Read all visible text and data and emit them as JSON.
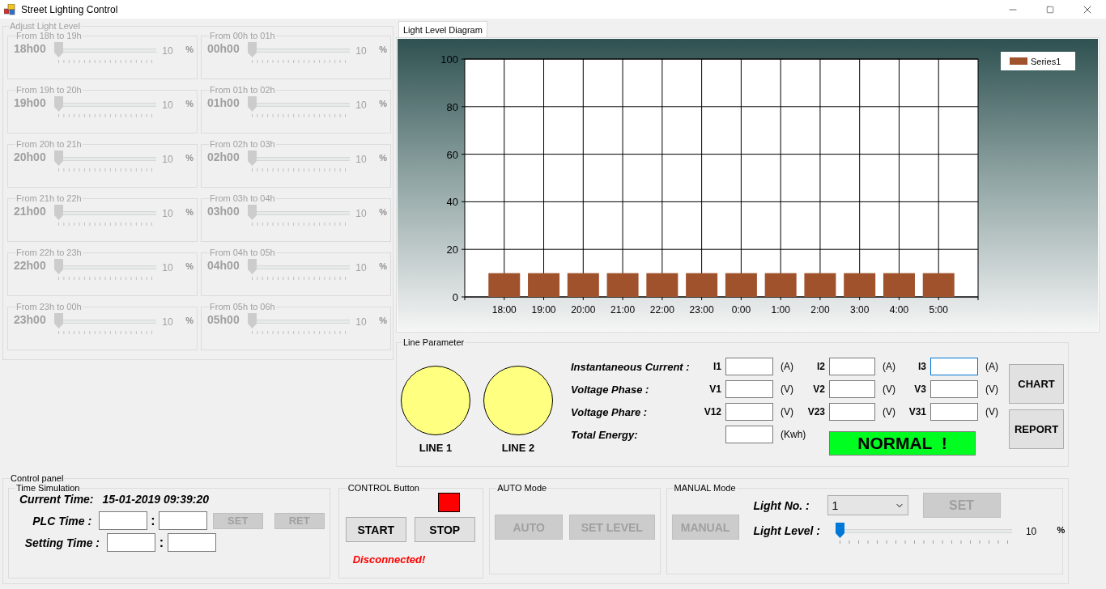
{
  "window": {
    "title": "Street Lighting Control"
  },
  "adjust_light_level": {
    "title": "Adjust Light Level",
    "disabled": true,
    "slots": [
      {
        "title": "From 18h to 19h",
        "hour": "18h00",
        "level": 0,
        "value": "10",
        "unit": "%"
      },
      {
        "title": "From 00h to 01h",
        "hour": "00h00",
        "level": 0,
        "value": "10",
        "unit": "%"
      },
      {
        "title": "From 19h to 20h",
        "hour": "19h00",
        "level": 0,
        "value": "10",
        "unit": "%"
      },
      {
        "title": "From 01h to 02h",
        "hour": "01h00",
        "level": 0,
        "value": "10",
        "unit": "%"
      },
      {
        "title": "From 20h to 21h",
        "hour": "20h00",
        "level": 0,
        "value": "10",
        "unit": "%"
      },
      {
        "title": "From 02h to 03h",
        "hour": "02h00",
        "level": 0,
        "value": "10",
        "unit": "%"
      },
      {
        "title": "From 21h to 22h",
        "hour": "21h00",
        "level": 0,
        "value": "10",
        "unit": "%"
      },
      {
        "title": "From 03h to 04h",
        "hour": "03h00",
        "level": 0,
        "value": "10",
        "unit": "%"
      },
      {
        "title": "From 22h to 23h",
        "hour": "22h00",
        "level": 0,
        "value": "10",
        "unit": "%"
      },
      {
        "title": "From 04h to 05h",
        "hour": "04h00",
        "level": 0,
        "value": "10",
        "unit": "%"
      },
      {
        "title": "From 23h to 00h",
        "hour": "23h00",
        "level": 0,
        "value": "10",
        "unit": "%"
      },
      {
        "title": "From 05h to 06h",
        "hour": "05h00",
        "level": 0,
        "value": "10",
        "unit": "%"
      }
    ]
  },
  "light_level_diagram": {
    "tab": {
      "label": "Light Level Diagram",
      "selected": true
    },
    "chart_data": {
      "type": "bar",
      "categories": [
        "18:00",
        "19:00",
        "20:00",
        "21:00",
        "22:00",
        "23:00",
        "0:00",
        "1:00",
        "2:00",
        "3:00",
        "4:00",
        "5:00"
      ],
      "series": [
        {
          "name": "Series1",
          "color": "#a0522d",
          "values": [
            10,
            10,
            10,
            10,
            10,
            10,
            10,
            10,
            10,
            10,
            10,
            10
          ]
        }
      ],
      "ylim": [
        0,
        100
      ],
      "yticks": [
        0,
        20,
        40,
        60,
        80,
        100
      ],
      "grid": true
    }
  },
  "line_parameter": {
    "title": "Line Parameter",
    "lines": [
      {
        "label": "LINE 1"
      },
      {
        "label": "LINE 2"
      }
    ],
    "rows": [
      {
        "label": "Instantaneous Current :",
        "cells": [
          {
            "name": "I1",
            "unit": "(A)",
            "focused": false
          },
          {
            "name": "I2",
            "unit": "(A)",
            "focused": false
          },
          {
            "name": "I3",
            "unit": "(A)",
            "focused": true
          }
        ]
      },
      {
        "label": "Voltage Phase :",
        "cells": [
          {
            "name": "V1",
            "unit": "(V)",
            "focused": false
          },
          {
            "name": "V2",
            "unit": "(V)",
            "focused": false
          },
          {
            "name": "V3",
            "unit": "(V)",
            "focused": false
          }
        ]
      },
      {
        "label": "Voltage Phare :",
        "cells": [
          {
            "name": "V12",
            "unit": "(V)",
            "focused": false
          },
          {
            "name": "V23",
            "unit": "(V)",
            "focused": false
          },
          {
            "name": "V31",
            "unit": "(V)",
            "focused": false
          }
        ]
      },
      {
        "label": "Total Energy:",
        "cells": [
          {
            "unit": "(Kwh)",
            "focused": false
          }
        ]
      }
    ],
    "status": "NORMAL  !",
    "buttons": [
      {
        "label": "CHART",
        "disabled": false
      },
      {
        "label": "REPORT",
        "disabled": false
      }
    ]
  },
  "control_panel": {
    "title": "Control panel",
    "time_simulation": {
      "title": "Time Simulation",
      "current_time_label": "Current Time:",
      "current_time": "15-01-2019 09:39:20",
      "rows": [
        {
          "label": "PLC Time :",
          "separator": ":",
          "buttons": [
            {
              "label": "SET",
              "disabled": true
            },
            {
              "label": "RET",
              "disabled": true
            }
          ]
        },
        {
          "label": "Setting Time :",
          "separator": ":"
        }
      ]
    },
    "control_buttons": {
      "title": "CONTROL Button",
      "indicator": {
        "color": "#ff0000"
      },
      "buttons": [
        {
          "label": "START",
          "disabled": false
        },
        {
          "label": "STOP",
          "disabled": false
        }
      ],
      "connection": "Disconnected!"
    },
    "auto_mode": {
      "title": "AUTO Mode",
      "buttons": [
        {
          "label": "AUTO",
          "disabled": true
        },
        {
          "label": "SET LEVEL",
          "disabled": true
        }
      ]
    },
    "manual_mode": {
      "title": "MANUAL Mode",
      "button": {
        "label": "MANUAL",
        "disabled": true
      },
      "light_no_label": "Light No. :",
      "light_no": "1",
      "set_button": {
        "label": "SET",
        "disabled": true
      },
      "light_level_label": "Light Level :",
      "level": 0,
      "value": "10",
      "unit": "%"
    }
  }
}
